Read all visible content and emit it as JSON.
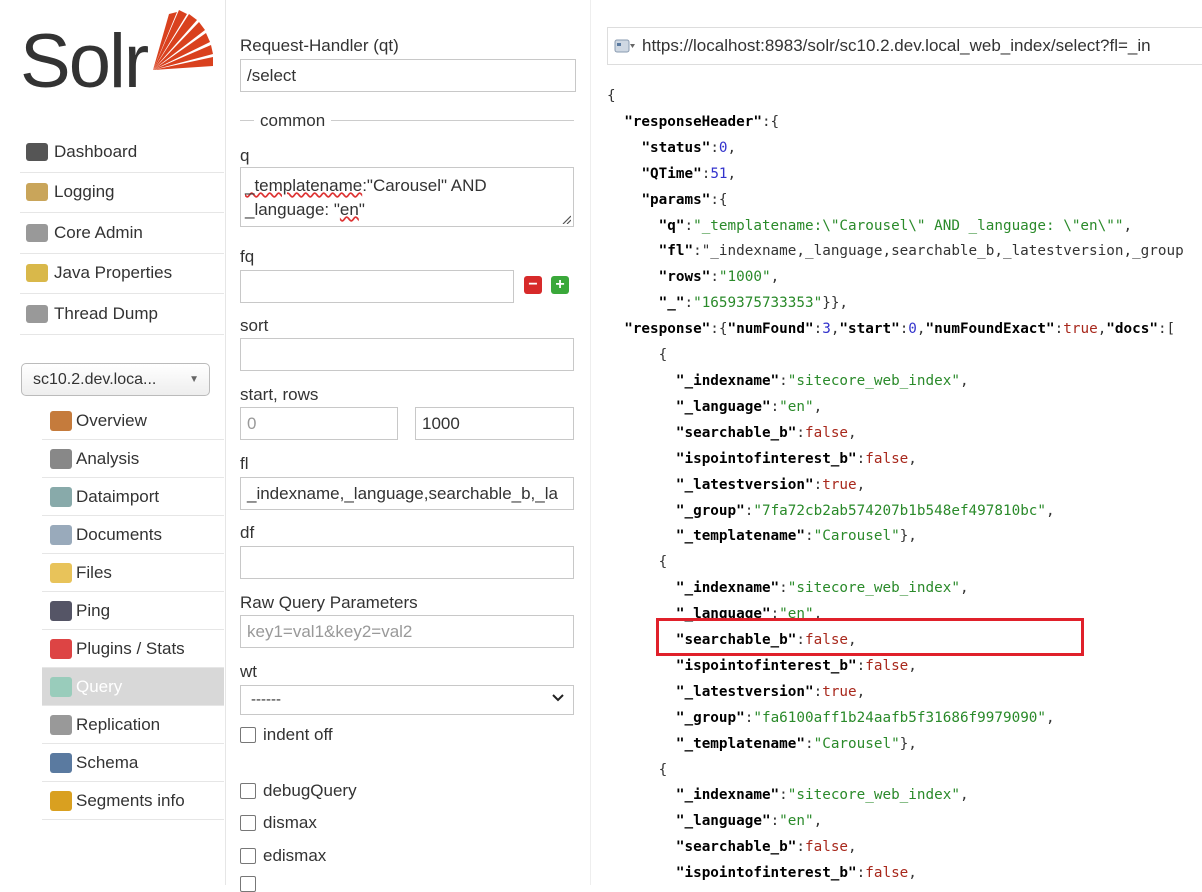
{
  "logo": {
    "text": "Solr"
  },
  "main_nav": [
    {
      "label": "Dashboard",
      "icon": "dashboard-icon"
    },
    {
      "label": "Logging",
      "icon": "logging-icon"
    },
    {
      "label": "Core Admin",
      "icon": "core-admin-icon"
    },
    {
      "label": "Java Properties",
      "icon": "java-properties-icon"
    },
    {
      "label": "Thread Dump",
      "icon": "thread-dump-icon"
    }
  ],
  "core_selector": {
    "value": "sc10.2.dev.loca..."
  },
  "core_nav": [
    {
      "label": "Overview",
      "icon": "overview-icon"
    },
    {
      "label": "Analysis",
      "icon": "analysis-icon"
    },
    {
      "label": "Dataimport",
      "icon": "dataimport-icon"
    },
    {
      "label": "Documents",
      "icon": "documents-icon"
    },
    {
      "label": "Files",
      "icon": "files-icon"
    },
    {
      "label": "Ping",
      "icon": "ping-icon"
    },
    {
      "label": "Plugins / Stats",
      "icon": "plugins-icon"
    },
    {
      "label": "Query",
      "icon": "query-icon"
    },
    {
      "label": "Replication",
      "icon": "replication-icon"
    },
    {
      "label": "Schema",
      "icon": "schema-icon"
    },
    {
      "label": "Segments info",
      "icon": "segments-icon"
    }
  ],
  "form": {
    "request_handler_label": "Request-Handler (qt)",
    "request_handler_value": "/select",
    "common_legend": "common",
    "q_label": "q",
    "q_line1_prefix": "_templatename",
    "q_line1_rest": ":\"Carousel\" AND",
    "q_line2_prefix": "_language: \"",
    "q_line2_mid": "en",
    "q_line2_end": "\"",
    "fq_label": "fq",
    "fq_value": "",
    "sort_label": "sort",
    "sort_value": "",
    "start_rows_label": "start, rows",
    "start_placeholder": "0",
    "rows_value": "1000",
    "fl_label": "fl",
    "fl_value": "_indexname,_language,searchable_b,_la",
    "df_label": "df",
    "df_value": "",
    "raw_label": "Raw Query Parameters",
    "raw_placeholder": "key1=val1&key2=val2",
    "wt_label": "wt",
    "wt_value": "------",
    "indent_label": "indent off",
    "debug_label": "debugQuery",
    "dismax_label": "dismax",
    "edismax_label": "edismax"
  },
  "response": {
    "url": "https://localhost:8983/solr/sc10.2.dev.local_web_index/select?fl=_in",
    "lines": [
      "{",
      "  \"responseHeader\":{",
      "    \"status\":0,",
      "    \"QTime\":51,",
      "    \"params\":{",
      "      \"q\":\"_templatename:\\\"Carousel\\\" AND _language: \\\"en\\\"\",",
      "      \"fl\":\"_indexname,_language,searchable_b,_latestversion,_group",
      "      \"rows\":\"1000\",",
      "      \"_\":\"1659375733353\"}},",
      "  \"response\":{\"numFound\":3,\"start\":0,\"numFoundExact\":true,\"docs\":[",
      "      {",
      "        \"_indexname\":\"sitecore_web_index\",",
      "        \"_language\":\"en\",",
      "        \"searchable_b\":false,",
      "        \"ispointofinterest_b\":false,",
      "        \"_latestversion\":true,",
      "        \"_group\":\"7fa72cb2ab574207b1b548ef497810bc\",",
      "        \"_templatename\":\"Carousel\"},",
      "      {",
      "        \"_indexname\":\"sitecore_web_index\",",
      "        \"_language\":\"en\",",
      "        \"searchable_b\":false,",
      "        \"ispointofinterest_b\":false,",
      "        \"_latestversion\":true,",
      "        \"_group\":\"fa6100aff1b24aafb5f31686f9979090\",",
      "        \"_templatename\":\"Carousel\"},",
      "      {",
      "        \"_indexname\":\"sitecore_web_index\",",
      "        \"_language\":\"en\",",
      "        \"searchable_b\":false,",
      "        \"ispointofinterest_b\":false,"
    ]
  },
  "colors": {
    "accent": "#d9411e",
    "highlight": "#e0202a",
    "json_string": "#2a8a2a",
    "json_number": "#3333cc",
    "json_bool": "#a8281c"
  }
}
